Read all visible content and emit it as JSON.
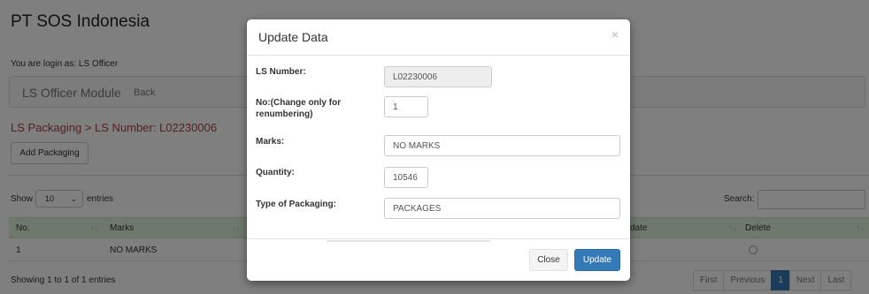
{
  "page": {
    "company": "PT SOS Indonesia",
    "login_text": "You are login as: LS Officer",
    "module_title": "LS Officer Module",
    "back_label": "Back",
    "breadcrumb": "LS Packaging > LS Number: L02230006",
    "add_button": "Add Packaging",
    "show_label": "Show",
    "length_value": "10",
    "entries_label": "entries",
    "search_label": "Search:",
    "search_value": ""
  },
  "table": {
    "headers": [
      "No.",
      "Marks",
      "date",
      "Delete"
    ],
    "rows": [
      {
        "no": "1",
        "marks": "NO MARKS"
      }
    ],
    "info": "Showing 1 to 1 of 1 entries"
  },
  "pagination": [
    "First",
    "Previous",
    "1",
    "Next",
    "Last"
  ],
  "modal": {
    "title": "Update Data",
    "close_icon": "×",
    "fields": {
      "ls_number_label": "LS Number:",
      "ls_number_value": "L02230006",
      "no_label": "No:(Change only for renumbering)",
      "no_value": "1",
      "marks_label": "Marks:",
      "marks_value": "NO MARKS",
      "quantity_label": "Quantity:",
      "quantity_value": "10546",
      "packaging_label": "Type of Packaging:",
      "packaging_value": "PACKAGES"
    },
    "close_button": "Close",
    "update_button": "Update"
  },
  "colors": {
    "header_green": "#dff0d8",
    "primary": "#337ab7",
    "breadcrumb_red": "#a94442"
  }
}
